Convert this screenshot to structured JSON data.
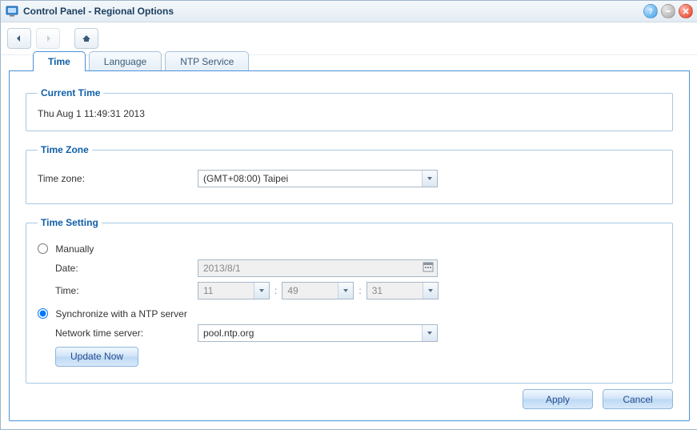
{
  "window": {
    "title": "Control Panel - Regional Options"
  },
  "tabs": {
    "time": "Time",
    "language": "Language",
    "ntp": "NTP Service"
  },
  "current_time": {
    "legend": "Current Time",
    "value": "Thu Aug 1 11:49:31 2013"
  },
  "timezone": {
    "legend": "Time Zone",
    "label": "Time zone:",
    "value": "(GMT+08:00) Taipei"
  },
  "timesetting": {
    "legend": "Time Setting",
    "manual_label": "Manually",
    "date_label": "Date:",
    "date_value": "2013/8/1",
    "time_label": "Time:",
    "hour": "11",
    "minute": "49",
    "second": "31",
    "ntp_label": "Synchronize with a NTP server",
    "server_label": "Network time server:",
    "server_value": "pool.ntp.org",
    "update_button": "Update Now",
    "selected": "ntp"
  },
  "footer": {
    "apply": "Apply",
    "cancel": "Cancel"
  }
}
